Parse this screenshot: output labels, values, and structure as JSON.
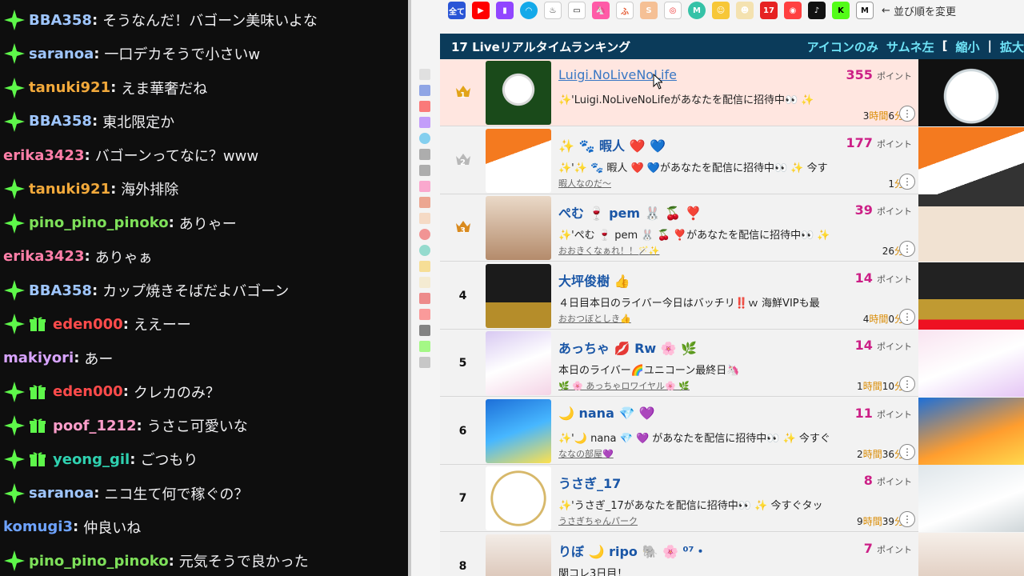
{
  "chat": {
    "messages": [
      {
        "user": "BBA358",
        "color": "#9fc6ff",
        "mod": true,
        "sub": false,
        "text": "そうなんだ！バゴーン美味いよな"
      },
      {
        "user": "saranoa",
        "color": "#9fc6ff",
        "mod": true,
        "sub": false,
        "text": "一口デカそうで小さいw"
      },
      {
        "user": "tanuki921",
        "color": "#f2a93b",
        "mod": true,
        "sub": false,
        "text": "えま華奢だね"
      },
      {
        "user": "BBA358",
        "color": "#9fc6ff",
        "mod": true,
        "sub": false,
        "text": "東北限定か"
      },
      {
        "user": "erika3423",
        "color": "#ff7fa8",
        "mod": false,
        "sub": false,
        "text": "バゴーンってなに？www"
      },
      {
        "user": "tanuki921",
        "color": "#f2a93b",
        "mod": true,
        "sub": false,
        "text": "海外排除"
      },
      {
        "user": "pino_pino_pinoko",
        "color": "#7ee05a",
        "mod": true,
        "sub": false,
        "text": "ありゃー"
      },
      {
        "user": "erika3423",
        "color": "#ff7fa8",
        "mod": false,
        "sub": false,
        "text": "ありゃぁ"
      },
      {
        "user": "BBA358",
        "color": "#9fc6ff",
        "mod": true,
        "sub": false,
        "text": "カップ焼きそばだよバゴーン"
      },
      {
        "user": "eden000",
        "color": "#ff4b4b",
        "mod": true,
        "sub": true,
        "text": "ええーー"
      },
      {
        "user": "makiyori",
        "color": "#d8a4ff",
        "mod": false,
        "sub": false,
        "text": "あー"
      },
      {
        "user": "eden000",
        "color": "#ff4b4b",
        "mod": true,
        "sub": true,
        "text": "クレカのみ？"
      },
      {
        "user": "poof_1212",
        "color": "#ff9ecb",
        "mod": true,
        "sub": true,
        "text": "うさこ可愛いな"
      },
      {
        "user": "yeong_gil",
        "color": "#2fd1b0",
        "mod": true,
        "sub": true,
        "text": "ごつもり"
      },
      {
        "user": "saranoa",
        "color": "#9fc6ff",
        "mod": true,
        "sub": false,
        "text": "ニコ生て何で稼ぐの？"
      },
      {
        "user": "komugi3",
        "color": "#6ea3ff",
        "mod": false,
        "sub": false,
        "text": "仲良いね"
      },
      {
        "user": "pino_pino_pinoko",
        "color": "#7ee05a",
        "mod": true,
        "sub": false,
        "text": "元気そうで良かった"
      }
    ]
  },
  "filterbar": {
    "all_label": "全て",
    "sort_label": "並び順を変更",
    "sort_arrow": "←"
  },
  "ranking": {
    "title": "17 Liveリアルタイムランキング",
    "controls": [
      "アイコンのみ",
      "サムネ左",
      "[",
      "縮小",
      "|",
      "拡大"
    ],
    "points_unit": "ポイント",
    "rows": [
      {
        "rank": "1",
        "crown": "gold",
        "name": "Luigi.NoLiveNoLife",
        "linked": true,
        "points": "355",
        "msg": "✨'Luigi.NoLiveNoLifeがあなたを配信に招待中👀 ✨",
        "sub": "",
        "time_a": "3",
        "time_u1": "時間",
        "time_b": "6",
        "time_u2": "分",
        "highlight": true
      },
      {
        "rank": "2",
        "crown": "silver",
        "name": "✨ 🐾 暇人 ❤️ 💙",
        "linked": false,
        "points": "177",
        "msg": "✨'✨ 🐾 暇人 ❤️ 💙があなたを配信に招待中👀 ✨ 今す",
        "sub": "暇人なのだ〜",
        "time_a": "",
        "time_u1": "",
        "time_b": "1",
        "time_u2": "分",
        "highlight": false
      },
      {
        "rank": "3",
        "crown": "bronze",
        "name": "ぺむ 🍷 pem 🐰 🍒 ❣️",
        "linked": false,
        "points": "39",
        "msg": "✨'ぺむ 🍷 pem 🐰 🍒 ❣️があなたを配信に招待中👀 ✨",
        "sub": "おおきくなぁれ！！🪄✨",
        "time_a": "",
        "time_u1": "",
        "time_b": "26",
        "time_u2": "分",
        "highlight": false
      },
      {
        "rank": "4",
        "crown": "",
        "name": "大坪俊樹 👍",
        "linked": false,
        "points": "14",
        "msg": "４日目本日のライバー今日はバッチリ‼️ｗ 海鮮VIPも最",
        "sub": "おおつぼとしき👍",
        "time_a": "4",
        "time_u1": "時間",
        "time_b": "0",
        "time_u2": "分",
        "highlight": false
      },
      {
        "rank": "5",
        "crown": "",
        "name": "あっちゃ 💋 Rw 🌸 🌿",
        "linked": false,
        "points": "14",
        "msg": "本日のライバー🌈ユニコーン最終日🦄",
        "sub": "🌿 🌸 あっちゃロワイヤル🌸 🌿",
        "time_a": "1",
        "time_u1": "時間",
        "time_b": "10",
        "time_u2": "分",
        "highlight": false
      },
      {
        "rank": "6",
        "crown": "",
        "name": "🌙 nana 💎 💜",
        "linked": false,
        "points": "11",
        "msg": "✨'🌙 nana 💎 💜 があなたを配信に招待中👀 ✨ 今すぐ",
        "sub": "ななの部屋💜",
        "time_a": "2",
        "time_u1": "時間",
        "time_b": "36",
        "time_u2": "分",
        "highlight": false
      },
      {
        "rank": "7",
        "crown": "",
        "name": "うさぎ_17",
        "linked": false,
        "points": "8",
        "msg": "✨'うさぎ_17があなたを配信に招待中👀 ✨ 今すぐタッ",
        "sub": "うさぎちゃんパーク",
        "time_a": "9",
        "time_u1": "時間",
        "time_b": "39",
        "time_u2": "分",
        "highlight": false
      },
      {
        "rank": "8",
        "crown": "",
        "name": "りぼ 🌙 ripo 🐘 🌸 ⁰⁷・",
        "linked": false,
        "points": "7",
        "msg": "関コレ3日目！",
        "sub": "",
        "time_a": "",
        "time_u1": "",
        "time_b": "",
        "time_u2": "",
        "highlight": false
      }
    ]
  }
}
